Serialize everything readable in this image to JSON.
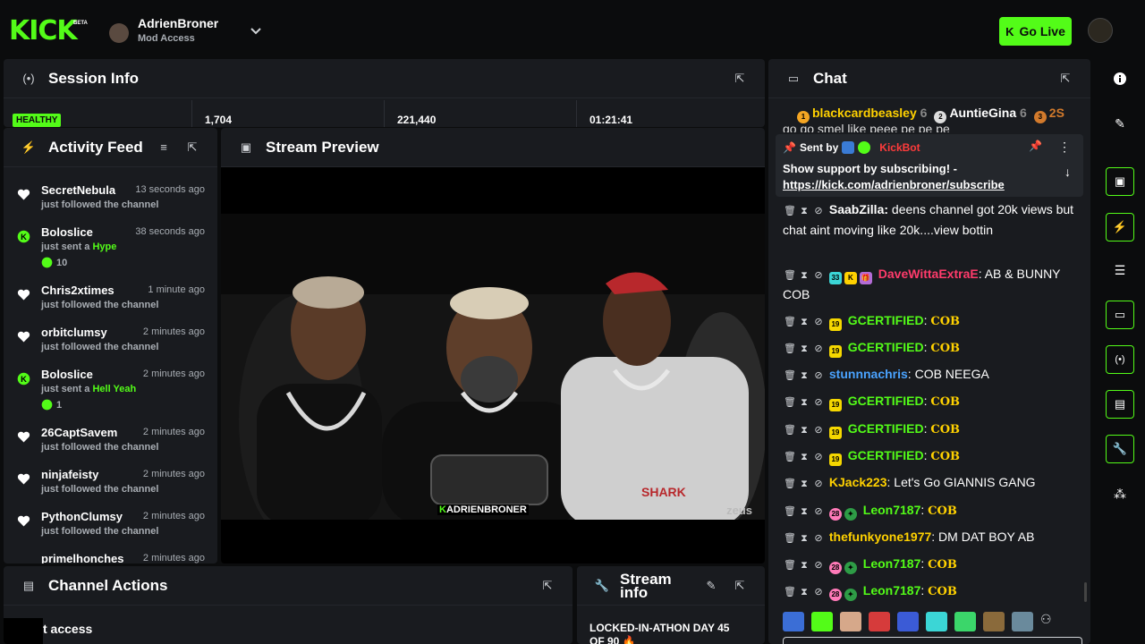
{
  "topbar": {
    "logo": "KICK",
    "logo_badge": "BETA",
    "channel_name": "AdrienBroner",
    "channel_role": "Mod Access",
    "go_live_label": "Go Live",
    "accent": "#53fc18"
  },
  "session": {
    "title": "Session Info",
    "status": "HEALTHY",
    "stat1": "1,704",
    "stat2": "221,440",
    "stat3": "01:21:41"
  },
  "activity": {
    "title": "Activity Feed",
    "items": [
      {
        "name": "SecretNebula",
        "time": "13 seconds ago",
        "desc": "just followed the channel",
        "type": "follow"
      },
      {
        "name": "Boloslice",
        "time": "38 seconds ago",
        "desc": "just sent a",
        "highlight": "Hype",
        "amount": "10",
        "type": "kicks"
      },
      {
        "name": "Chris2xtimes",
        "time": "1 minute ago",
        "desc": "just followed the channel",
        "type": "follow"
      },
      {
        "name": "orbitclumsy",
        "time": "2 minutes ago",
        "desc": "just followed the channel",
        "type": "follow"
      },
      {
        "name": "Boloslice",
        "time": "2 minutes ago",
        "desc": "just sent a",
        "highlight": "Hell Yeah",
        "amount": "1",
        "type": "kicks"
      },
      {
        "name": "26CaptSavem",
        "time": "2 minutes ago",
        "desc": "just followed the channel",
        "type": "follow"
      },
      {
        "name": "ninjafeisty",
        "time": "2 minutes ago",
        "desc": "just followed the channel",
        "type": "follow"
      },
      {
        "name": "PythonClumsy",
        "time": "2 minutes ago",
        "desc": "just followed the channel",
        "type": "follow"
      },
      {
        "name": "primelhonches",
        "time": "2 minutes ago",
        "desc": "",
        "type": "follow"
      }
    ]
  },
  "preview": {
    "title": "Stream Preview",
    "watermark": "ADRIENBRONER",
    "corner_mark": "zeus"
  },
  "actions": {
    "title": "Channel Actions",
    "row": "t access"
  },
  "stream_info": {
    "title_line1": "Stream",
    "title_line2": "info",
    "text_line1": "LOCKED-IN-ATHON DAY 45",
    "text_line2": "OF 90 🔥"
  },
  "chat": {
    "title": "Chat",
    "top_gifters": [
      {
        "rank": "1",
        "name": "blackcardbeasley",
        "count": "6"
      },
      {
        "rank": "2",
        "name": "AuntieGina",
        "count": "6"
      },
      {
        "rank": "3",
        "name": "2S",
        "count": ""
      }
    ],
    "overflow_line": "go go smel like peee pe pe pe",
    "pinned": {
      "sent_by": "Sent by",
      "sender": "KickBot",
      "text": "Show support by subscribing! -",
      "link": "https://kick.com/adrienbroner/subscribe"
    },
    "messages": [
      {
        "user": "SaabZilla",
        "color": "#ffffff",
        "text": " deens channel got 20k views but chat aint moving like 20k....view bottin",
        "lines": 3
      },
      {
        "user": "DaveWittaExtraE",
        "color": "#ff3b6b",
        "text": " AB & BUNNY COB",
        "lines": 2,
        "badges": "sub33"
      },
      {
        "user": "GCERTIFIED",
        "color": "#53fc18",
        "text": "COB",
        "cob": true,
        "badges": "sub19"
      },
      {
        "user": "GCERTIFIED",
        "color": "#53fc18",
        "text": "COB",
        "cob": true,
        "badges": "sub19"
      },
      {
        "user": "stunnnachris",
        "color": "#4aa3ff",
        "text": " COB NEEGA"
      },
      {
        "user": "GCERTIFIED",
        "color": "#53fc18",
        "text": "COB",
        "cob": true,
        "badges": "sub19"
      },
      {
        "user": "GCERTIFIED",
        "color": "#53fc18",
        "text": "COB",
        "cob": true,
        "badges": "sub19"
      },
      {
        "user": "GCERTIFIED",
        "color": "#53fc18",
        "text": "COB",
        "cob": true,
        "badges": "sub19"
      },
      {
        "user": "KJack223",
        "color": "#ffd100",
        "text": " Let's Go GIANNIS GANG"
      },
      {
        "user": "Leon7187",
        "color": "#53fc18",
        "text": "COB",
        "cob": true,
        "badges": "sub28"
      },
      {
        "user": "thefunkyone1977",
        "color": "#ffd100",
        "text": " DM DAT BOY AB"
      },
      {
        "user": "Leon7187",
        "color": "#53fc18",
        "text": "COB",
        "cob": true,
        "badges": "sub28"
      },
      {
        "user": "Leon7187",
        "color": "#53fc18",
        "text": "COB",
        "cob": true,
        "badges": "sub28"
      }
    ],
    "sub_badges": {
      "sub19": "19",
      "sub33": "33",
      "sub28": "28"
    }
  }
}
